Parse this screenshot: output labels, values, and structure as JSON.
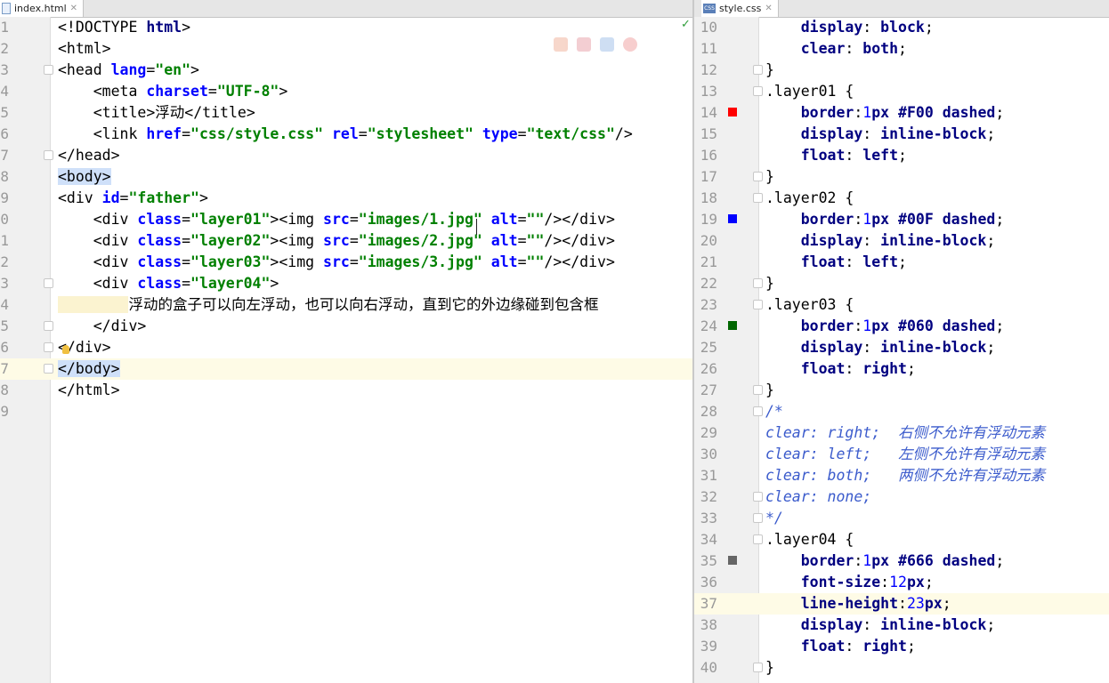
{
  "left_editor": {
    "tab_label": "index.html",
    "lines": [
      {
        "num": "1",
        "segments": [
          {
            "t": "<!DOCTYPE ",
            "c": "#000"
          },
          {
            "t": "html",
            "c": "#000080",
            "b": true
          },
          {
            "t": ">",
            "c": "#000"
          }
        ]
      },
      {
        "num": "2",
        "segments": [
          {
            "t": "<html>",
            "c": "#000"
          }
        ]
      },
      {
        "num": "3",
        "segments": [
          {
            "t": "<head ",
            "c": "#000"
          },
          {
            "t": "lang",
            "c": "#0000ff",
            "b": true
          },
          {
            "t": "=",
            "c": "#000"
          },
          {
            "t": "\"en\"",
            "c": "#008000",
            "b": true
          },
          {
            "t": ">",
            "c": "#000"
          }
        ]
      },
      {
        "num": "4",
        "segments": [
          {
            "t": "    <meta ",
            "c": "#000"
          },
          {
            "t": "charset",
            "c": "#0000ff",
            "b": true
          },
          {
            "t": "=",
            "c": "#000"
          },
          {
            "t": "\"UTF-8\"",
            "c": "#008000",
            "b": true
          },
          {
            "t": ">",
            "c": "#000"
          }
        ]
      },
      {
        "num": "5",
        "segments": [
          {
            "t": "    <title>",
            "c": "#000"
          },
          {
            "t": "浮动",
            "c": "#000"
          },
          {
            "t": "</title>",
            "c": "#000"
          }
        ]
      },
      {
        "num": "6",
        "segments": [
          {
            "t": "    <link ",
            "c": "#000"
          },
          {
            "t": "href",
            "c": "#0000ff",
            "b": true
          },
          {
            "t": "=",
            "c": "#000"
          },
          {
            "t": "\"css/style.css\" ",
            "c": "#008000",
            "b": true
          },
          {
            "t": "rel",
            "c": "#0000ff",
            "b": true
          },
          {
            "t": "=",
            "c": "#000"
          },
          {
            "t": "\"stylesheet\" ",
            "c": "#008000",
            "b": true
          },
          {
            "t": "type",
            "c": "#0000ff",
            "b": true
          },
          {
            "t": "=",
            "c": "#000"
          },
          {
            "t": "\"text/css\"",
            "c": "#008000",
            "b": true
          },
          {
            "t": "/>",
            "c": "#000"
          }
        ]
      },
      {
        "num": "7",
        "segments": [
          {
            "t": "</head>",
            "c": "#000"
          }
        ]
      },
      {
        "num": "8",
        "segments": [
          {
            "t": "<body>",
            "c": "#000",
            "hl": "tag"
          }
        ]
      },
      {
        "num": "9",
        "segments": [
          {
            "t": "<div ",
            "c": "#000"
          },
          {
            "t": "id",
            "c": "#0000ff",
            "b": true
          },
          {
            "t": "=",
            "c": "#000"
          },
          {
            "t": "\"father\"",
            "c": "#008000",
            "b": true
          },
          {
            "t": ">",
            "c": "#000"
          }
        ]
      },
      {
        "num": "0",
        "segments": [
          {
            "t": "    <div ",
            "c": "#000"
          },
          {
            "t": "class",
            "c": "#0000ff",
            "b": true
          },
          {
            "t": "=",
            "c": "#000"
          },
          {
            "t": "\"layer01\"",
            "c": "#008000",
            "b": true
          },
          {
            "t": "><img ",
            "c": "#000"
          },
          {
            "t": "src",
            "c": "#0000ff",
            "b": true
          },
          {
            "t": "=",
            "c": "#000"
          },
          {
            "t": "\"images/1.jpg\" ",
            "c": "#008000",
            "b": true
          },
          {
            "t": "alt",
            "c": "#0000ff",
            "b": true
          },
          {
            "t": "=",
            "c": "#000"
          },
          {
            "t": "\"\"",
            "c": "#008000",
            "b": true
          },
          {
            "t": "/></div>",
            "c": "#000"
          }
        ]
      },
      {
        "num": "1",
        "segments": [
          {
            "t": "    <div ",
            "c": "#000"
          },
          {
            "t": "class",
            "c": "#0000ff",
            "b": true
          },
          {
            "t": "=",
            "c": "#000"
          },
          {
            "t": "\"layer02\"",
            "c": "#008000",
            "b": true
          },
          {
            "t": "><img ",
            "c": "#000"
          },
          {
            "t": "src",
            "c": "#0000ff",
            "b": true
          },
          {
            "t": "=",
            "c": "#000"
          },
          {
            "t": "\"images/2.jpg\" ",
            "c": "#008000",
            "b": true
          },
          {
            "t": "alt",
            "c": "#0000ff",
            "b": true
          },
          {
            "t": "=",
            "c": "#000"
          },
          {
            "t": "\"\"",
            "c": "#008000",
            "b": true
          },
          {
            "t": "/></div>",
            "c": "#000"
          }
        ]
      },
      {
        "num": "2",
        "segments": [
          {
            "t": "    <div ",
            "c": "#000"
          },
          {
            "t": "class",
            "c": "#0000ff",
            "b": true
          },
          {
            "t": "=",
            "c": "#000"
          },
          {
            "t": "\"layer03\"",
            "c": "#008000",
            "b": true
          },
          {
            "t": "><img ",
            "c": "#000"
          },
          {
            "t": "src",
            "c": "#0000ff",
            "b": true
          },
          {
            "t": "=",
            "c": "#000"
          },
          {
            "t": "\"images/3.jpg\" ",
            "c": "#008000",
            "b": true
          },
          {
            "t": "alt",
            "c": "#0000ff",
            "b": true
          },
          {
            "t": "=",
            "c": "#000"
          },
          {
            "t": "\"\"",
            "c": "#008000",
            "b": true
          },
          {
            "t": "/></div>",
            "c": "#000"
          }
        ]
      },
      {
        "num": "3",
        "segments": [
          {
            "t": "    <div ",
            "c": "#000"
          },
          {
            "t": "class",
            "c": "#0000ff",
            "b": true
          },
          {
            "t": "=",
            "c": "#000"
          },
          {
            "t": "\"layer04\"",
            "c": "#008000",
            "b": true
          },
          {
            "t": ">",
            "c": "#000"
          }
        ]
      },
      {
        "num": "4",
        "segments": [
          {
            "t": "        ",
            "c": "#000",
            "hl": "tab"
          },
          {
            "t": "浮动的盒子可以向左浮动，也可以向右浮动，直到它的外边缘碰到包含框",
            "c": "#000"
          }
        ]
      },
      {
        "num": "5",
        "segments": [
          {
            "t": "    </div>",
            "c": "#000"
          }
        ]
      },
      {
        "num": "6",
        "segments": [
          {
            "t": "</div>",
            "c": "#000"
          }
        ]
      },
      {
        "num": "7",
        "segments": [
          {
            "t": "</body>",
            "c": "#000",
            "hl": "tag"
          }
        ],
        "highlight": true
      },
      {
        "num": "8",
        "segments": [
          {
            "t": "</html>",
            "c": "#000"
          }
        ]
      },
      {
        "num": "9",
        "segments": []
      }
    ]
  },
  "right_editor": {
    "tab_label": "style.css",
    "lines": [
      {
        "num": "10",
        "segments": [
          {
            "t": "    display",
            "c": "#000080",
            "b": true
          },
          {
            "t": ": ",
            "c": "#000"
          },
          {
            "t": "block",
            "c": "#000080",
            "b": true
          },
          {
            "t": ";",
            "c": "#000"
          }
        ]
      },
      {
        "num": "11",
        "segments": [
          {
            "t": "    clear",
            "c": "#000080",
            "b": true
          },
          {
            "t": ": ",
            "c": "#000"
          },
          {
            "t": "both",
            "c": "#000080",
            "b": true
          },
          {
            "t": ";",
            "c": "#000"
          }
        ]
      },
      {
        "num": "12",
        "segments": [
          {
            "t": "}",
            "c": "#000"
          }
        ]
      },
      {
        "num": "13",
        "segments": [
          {
            "t": ".layer01 {",
            "c": "#000"
          }
        ]
      },
      {
        "num": "14",
        "marker": "#ff0000",
        "segments": [
          {
            "t": "    border",
            "c": "#000080",
            "b": true
          },
          {
            "t": ":",
            "c": "#000"
          },
          {
            "t": "1",
            "c": "#0000ff"
          },
          {
            "t": "px ",
            "c": "#000080",
            "b": true
          },
          {
            "t": "#F00 ",
            "c": "#000080",
            "b": true
          },
          {
            "t": "dashed",
            "c": "#000080",
            "b": true
          },
          {
            "t": ";",
            "c": "#000"
          }
        ]
      },
      {
        "num": "15",
        "segments": [
          {
            "t": "    display",
            "c": "#000080",
            "b": true
          },
          {
            "t": ": ",
            "c": "#000"
          },
          {
            "t": "inline-block",
            "c": "#000080",
            "b": true
          },
          {
            "t": ";",
            "c": "#000"
          }
        ]
      },
      {
        "num": "16",
        "segments": [
          {
            "t": "    float",
            "c": "#000080",
            "b": true
          },
          {
            "t": ": ",
            "c": "#000"
          },
          {
            "t": "left",
            "c": "#000080",
            "b": true
          },
          {
            "t": ";",
            "c": "#000"
          }
        ]
      },
      {
        "num": "17",
        "segments": [
          {
            "t": "}",
            "c": "#000"
          }
        ]
      },
      {
        "num": "18",
        "segments": [
          {
            "t": ".layer02 {",
            "c": "#000"
          }
        ]
      },
      {
        "num": "19",
        "marker": "#0000ff",
        "segments": [
          {
            "t": "    border",
            "c": "#000080",
            "b": true
          },
          {
            "t": ":",
            "c": "#000"
          },
          {
            "t": "1",
            "c": "#0000ff"
          },
          {
            "t": "px ",
            "c": "#000080",
            "b": true
          },
          {
            "t": "#00F ",
            "c": "#000080",
            "b": true
          },
          {
            "t": "dashed",
            "c": "#000080",
            "b": true
          },
          {
            "t": ";",
            "c": "#000"
          }
        ]
      },
      {
        "num": "20",
        "segments": [
          {
            "t": "    display",
            "c": "#000080",
            "b": true
          },
          {
            "t": ": ",
            "c": "#000"
          },
          {
            "t": "inline-block",
            "c": "#000080",
            "b": true
          },
          {
            "t": ";",
            "c": "#000"
          }
        ]
      },
      {
        "num": "21",
        "segments": [
          {
            "t": "    float",
            "c": "#000080",
            "b": true
          },
          {
            "t": ": ",
            "c": "#000"
          },
          {
            "t": "left",
            "c": "#000080",
            "b": true
          },
          {
            "t": ";",
            "c": "#000"
          }
        ]
      },
      {
        "num": "22",
        "segments": [
          {
            "t": "}",
            "c": "#000"
          }
        ]
      },
      {
        "num": "23",
        "segments": [
          {
            "t": ".layer03 {",
            "c": "#000"
          }
        ]
      },
      {
        "num": "24",
        "marker": "#006600",
        "segments": [
          {
            "t": "    border",
            "c": "#000080",
            "b": true
          },
          {
            "t": ":",
            "c": "#000"
          },
          {
            "t": "1",
            "c": "#0000ff"
          },
          {
            "t": "px ",
            "c": "#000080",
            "b": true
          },
          {
            "t": "#060 ",
            "c": "#000080",
            "b": true
          },
          {
            "t": "dashed",
            "c": "#000080",
            "b": true
          },
          {
            "t": ";",
            "c": "#000"
          }
        ]
      },
      {
        "num": "25",
        "segments": [
          {
            "t": "    display",
            "c": "#000080",
            "b": true
          },
          {
            "t": ": ",
            "c": "#000"
          },
          {
            "t": "inline-block",
            "c": "#000080",
            "b": true
          },
          {
            "t": ";",
            "c": "#000"
          }
        ]
      },
      {
        "num": "26",
        "segments": [
          {
            "t": "    float",
            "c": "#000080",
            "b": true
          },
          {
            "t": ": ",
            "c": "#000"
          },
          {
            "t": "right",
            "c": "#000080",
            "b": true
          },
          {
            "t": ";",
            "c": "#000"
          }
        ]
      },
      {
        "num": "27",
        "segments": [
          {
            "t": "}",
            "c": "#000"
          }
        ]
      },
      {
        "num": "28",
        "segments": [
          {
            "t": "/*",
            "c": "#3b5bcc",
            "i": true
          }
        ]
      },
      {
        "num": "29",
        "segments": [
          {
            "t": "clear: right;  ",
            "c": "#3b5bcc",
            "i": true
          },
          {
            "t": "右侧不允许有浮动元素",
            "c": "#3b5bcc",
            "i": true
          }
        ]
      },
      {
        "num": "30",
        "segments": [
          {
            "t": "clear: left;   ",
            "c": "#3b5bcc",
            "i": true
          },
          {
            "t": "左侧不允许有浮动元素",
            "c": "#3b5bcc",
            "i": true
          }
        ]
      },
      {
        "num": "31",
        "segments": [
          {
            "t": "clear: both;   ",
            "c": "#3b5bcc",
            "i": true
          },
          {
            "t": "两侧不允许有浮动元素",
            "c": "#3b5bcc",
            "i": true
          }
        ]
      },
      {
        "num": "32",
        "segments": [
          {
            "t": "clear: none;",
            "c": "#3b5bcc",
            "i": true
          }
        ]
      },
      {
        "num": "33",
        "segments": [
          {
            "t": "*/",
            "c": "#3b5bcc",
            "i": true
          }
        ]
      },
      {
        "num": "34",
        "segments": [
          {
            "t": ".layer04 {",
            "c": "#000"
          }
        ]
      },
      {
        "num": "35",
        "marker": "#666666",
        "segments": [
          {
            "t": "    border",
            "c": "#000080",
            "b": true
          },
          {
            "t": ":",
            "c": "#000"
          },
          {
            "t": "1",
            "c": "#0000ff"
          },
          {
            "t": "px ",
            "c": "#000080",
            "b": true
          },
          {
            "t": "#666 ",
            "c": "#000080",
            "b": true
          },
          {
            "t": "dashed",
            "c": "#000080",
            "b": true
          },
          {
            "t": ";",
            "c": "#000"
          }
        ]
      },
      {
        "num": "36",
        "segments": [
          {
            "t": "    font-size",
            "c": "#000080",
            "b": true
          },
          {
            "t": ":",
            "c": "#000"
          },
          {
            "t": "12",
            "c": "#0000ff"
          },
          {
            "t": "px",
            "c": "#000080",
            "b": true
          },
          {
            "t": ";",
            "c": "#000"
          }
        ]
      },
      {
        "num": "37",
        "highlight": true,
        "segments": [
          {
            "t": "    line-height",
            "c": "#000080",
            "b": true
          },
          {
            "t": ":",
            "c": "#000"
          },
          {
            "t": "23",
            "c": "#0000ff"
          },
          {
            "t": "px",
            "c": "#000080",
            "b": true
          },
          {
            "t": ";",
            "c": "#000"
          }
        ]
      },
      {
        "num": "38",
        "segments": [
          {
            "t": "    display",
            "c": "#000080",
            "b": true
          },
          {
            "t": ": ",
            "c": "#000"
          },
          {
            "t": "inline-block",
            "c": "#000080",
            "b": true
          },
          {
            "t": ";",
            "c": "#000"
          }
        ]
      },
      {
        "num": "39",
        "segments": [
          {
            "t": "    float",
            "c": "#000080",
            "b": true
          },
          {
            "t": ": ",
            "c": "#000"
          },
          {
            "t": "right",
            "c": "#000080",
            "b": true
          },
          {
            "t": ";",
            "c": "#000"
          }
        ]
      },
      {
        "num": "40",
        "segments": [
          {
            "t": "}",
            "c": "#000"
          }
        ]
      }
    ]
  },
  "icons": {
    "left_tab": "html-file-icon",
    "right_tab": "css-file-icon",
    "close": "close-icon",
    "status": "check-icon",
    "hint": "lightbulb-icon"
  },
  "colors": {
    "tag_highlight": "#cfe0f9",
    "current_line": "#fefbe6"
  }
}
